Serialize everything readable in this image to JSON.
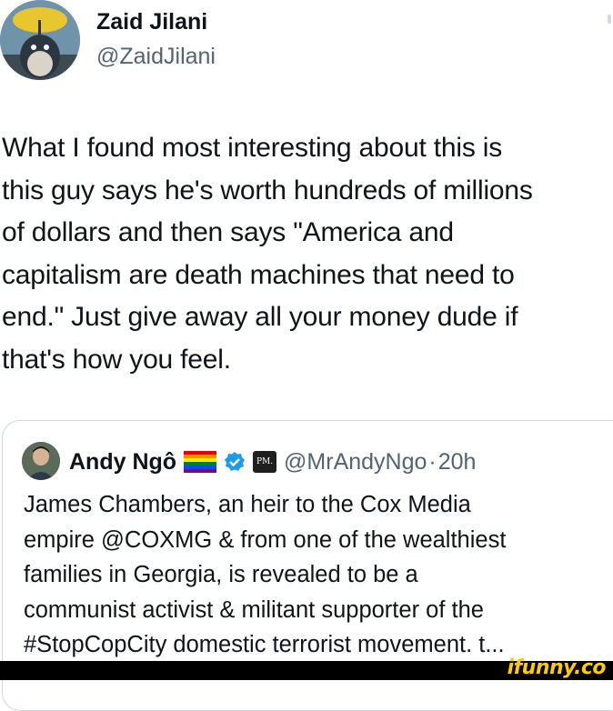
{
  "tweet": {
    "display_name": "Zaid Jilani",
    "handle": "@ZaidJilani",
    "text": "What I found most interesting about this is\nthis guy says he's worth hundreds of millions\nof dollars and then says \"America and\ncapitalism are death machines that need to\nend.\" Just give away all your money dude if\nthat's how you feel."
  },
  "quoted_tweet": {
    "display_name": "Andy Ngô",
    "handle": "@MrAndyNgo",
    "separator": "·",
    "time": "20h",
    "affiliate_badge": "PM.",
    "text": "James Chambers, an heir to the Cox Media\nempire @COXMG & from one of the wealthiest\nfamilies in Georgia, is revealed to be a\ncommunist activist & militant supporter of the\n#StopCopCity domestic terrorist movement. t..."
  },
  "watermark": "ifunny.co",
  "icons": [
    "avatar",
    "rainbow-flag-icon",
    "verified-check-icon",
    "pm-affiliate-icon",
    "more-icon"
  ],
  "colors": {
    "primary_text": "#0f1419",
    "secondary_text": "#536471",
    "verified": "#1d9bf0",
    "border": "#cfd9de",
    "watermark": "#ffcc00"
  }
}
